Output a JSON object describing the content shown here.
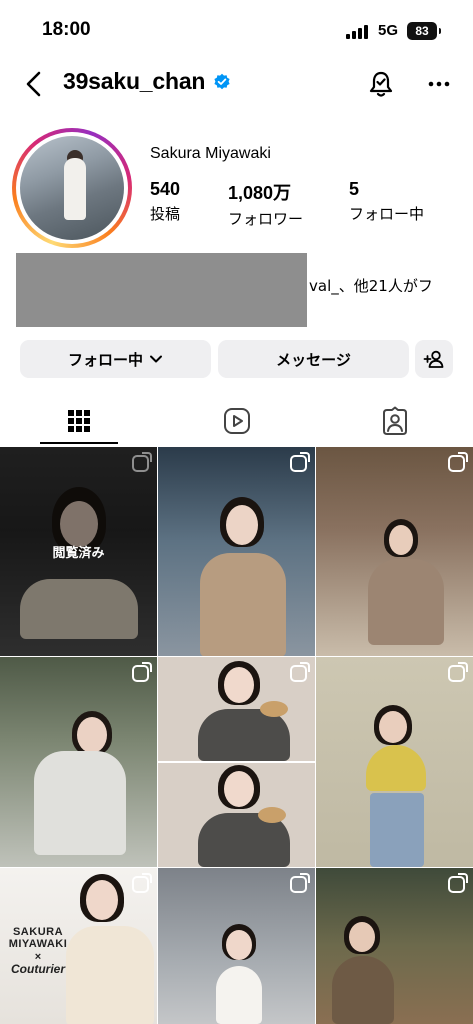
{
  "status_bar": {
    "time": "18:00",
    "network": "5G",
    "battery": "83"
  },
  "header": {
    "username": "39saku_chan"
  },
  "profile": {
    "full_name": "Sakura Miyawaki",
    "stats": [
      {
        "value": "540",
        "label": "投稿"
      },
      {
        "value": "1,080万",
        "label": "フォロワー"
      },
      {
        "value": "5",
        "label": "フォロー中"
      }
    ],
    "followed_by": "val_、他21人がフ"
  },
  "actions": {
    "follow_label": "フォロー中",
    "message_label": "メッセージ"
  },
  "grid": {
    "seen_label": "閲覧済み"
  },
  "ad": {
    "line1": "SAKURA",
    "line2": "MIYAWAKI",
    "line3": "×",
    "line4": "Couturier"
  },
  "colors": {
    "accent": "#0095f6",
    "button_bg": "#efeff1",
    "ring": [
      "#feda75",
      "#fa7e1e",
      "#d62976",
      "#962fbf"
    ]
  },
  "icons": [
    "back-icon",
    "verified-icon",
    "notification-bell-icon",
    "more-icon",
    "chevron-down-icon",
    "add-person-icon",
    "grid-icon",
    "reels-icon",
    "tagged-icon",
    "carousel-icon"
  ]
}
